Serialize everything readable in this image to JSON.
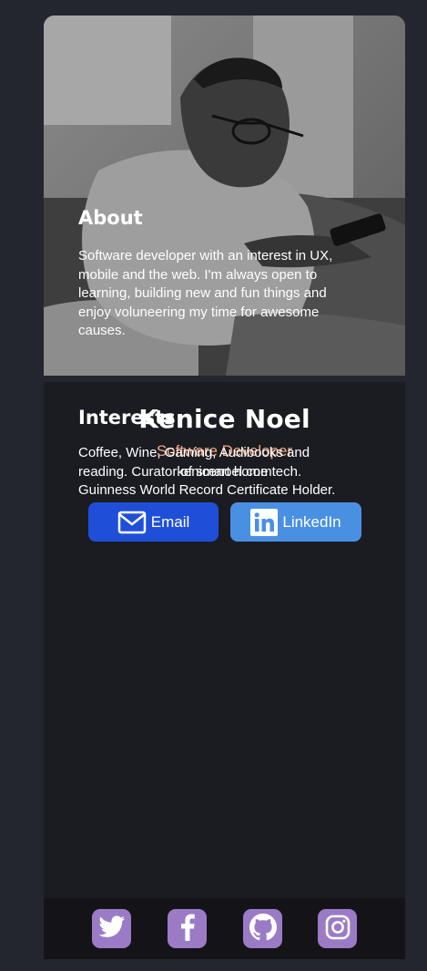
{
  "profile": {
    "name": "Kenice Noel",
    "role": "Software Developer",
    "website": "kenicenoel.com"
  },
  "buttons": {
    "email_label": "Email",
    "email_icon": "mail-icon",
    "linkedin_label": "LinkedIn",
    "linkedin_icon": "linkedin-icon"
  },
  "about": {
    "title": "About",
    "body": "Software developer with an interest in UX, mobile and the web. I'm always open to learning, building new and fun things and enjoy voluneering my time for awesome causes."
  },
  "interests": {
    "title": "Interests",
    "body": "Coffee, Wine, Gaming, Audibooks and reading. Curator of smart home tech. Guinness World Record Certificate Holder."
  },
  "social": [
    {
      "icon": "twitter-icon"
    },
    {
      "icon": "facebook-icon"
    },
    {
      "icon": "github-icon"
    },
    {
      "icon": "instagram-icon"
    }
  ],
  "colors": {
    "page_background": "#23252f",
    "card_background": "#1b1c22",
    "role_text": "#f3a683",
    "email_button": "#1f4fd8",
    "linkedin_button": "#4a90e2",
    "social_icon_background": "#9b7bc6"
  }
}
